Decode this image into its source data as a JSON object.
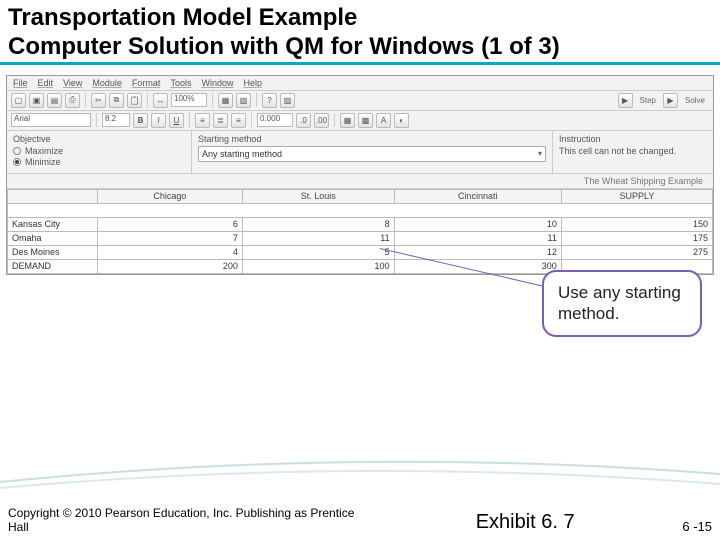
{
  "slide": {
    "title": "Transportation Model Example\nComputer Solution with QM for Windows (1 of 3)"
  },
  "menubar": [
    "File",
    "Edit",
    "View",
    "Module",
    "Format",
    "Tools",
    "Window",
    "Help"
  ],
  "toolbar1": {
    "zoom": "100%",
    "step_label": "Step",
    "solve_label": "Solve"
  },
  "toolbar2": {
    "font": "Arial",
    "size": "8.2",
    "numfmt": "0.000"
  },
  "panels": {
    "objective_title": "Objective",
    "maximize_label": "Maximize",
    "minimize_label": "Minimize",
    "starting_title": "Starting method",
    "starting_value": "Any starting method",
    "instruction_title": "Instruction",
    "instruction_text": "This cell can not be changed."
  },
  "example_title": "The Wheat Shipping Example",
  "table": {
    "columns": [
      "Chicago",
      "St. Louis",
      "Cincinnati",
      "SUPPLY"
    ],
    "rows": [
      {
        "name": "Kansas City",
        "cells": [
          "6",
          "8",
          "10",
          "150"
        ]
      },
      {
        "name": "Omaha",
        "cells": [
          "7",
          "11",
          "11",
          "175"
        ]
      },
      {
        "name": "Des Moines",
        "cells": [
          "4",
          "5",
          "12",
          "275"
        ]
      },
      {
        "name": "DEMAND",
        "cells": [
          "200",
          "100",
          "300",
          ""
        ]
      }
    ]
  },
  "callout_text": "Use any starting method.",
  "footer": {
    "copyright": "Copyright © 2010 Pearson Education, Inc. Publishing as Prentice Hall",
    "exhibit": "Exhibit 6. 7",
    "page": "6 -15"
  }
}
